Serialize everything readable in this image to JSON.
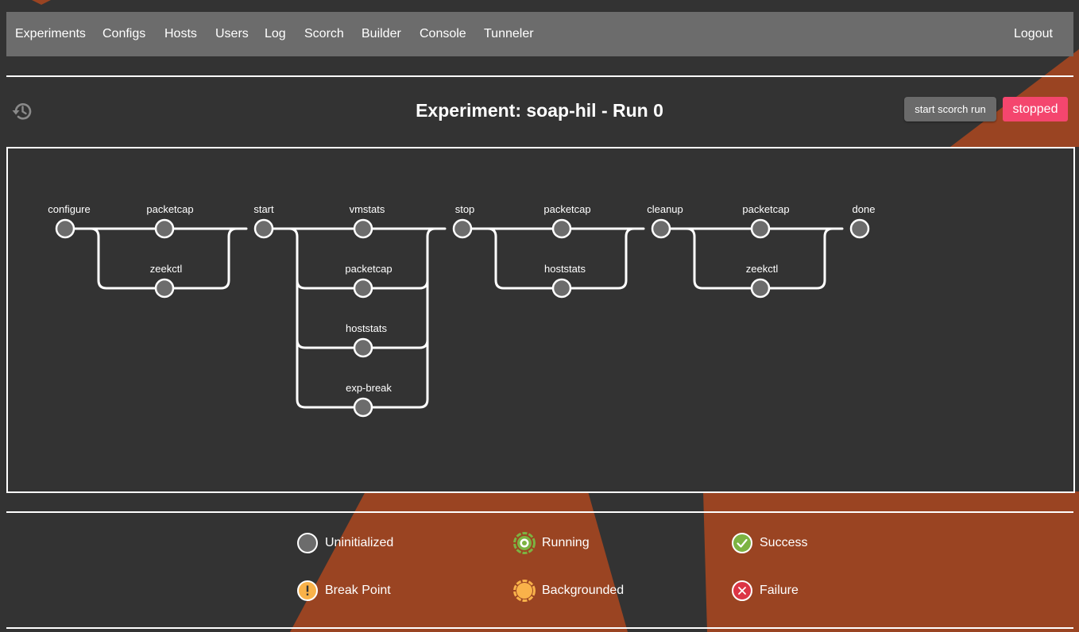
{
  "nav": {
    "items": [
      "Experiments",
      "Configs",
      "Hosts",
      "Users",
      "Log",
      "Scorch",
      "Builder",
      "Console",
      "Tunneler"
    ],
    "logout": "Logout"
  },
  "header": {
    "title": "Experiment: soap-hil - Run 0",
    "history_icon": "history-icon",
    "run_button": "start scorch run",
    "status": "stopped",
    "status_color": "#f4466e"
  },
  "pipeline": {
    "nodes": [
      {
        "id": "configure",
        "label": "configure"
      },
      {
        "id": "packetcap1",
        "label": "packetcap"
      },
      {
        "id": "zeekctl1",
        "label": "zeekctl"
      },
      {
        "id": "start",
        "label": "start"
      },
      {
        "id": "vmstats",
        "label": "vmstats"
      },
      {
        "id": "packetcap2",
        "label": "packetcap"
      },
      {
        "id": "hoststats1",
        "label": "hoststats"
      },
      {
        "id": "exp-break",
        "label": "exp-break"
      },
      {
        "id": "stop",
        "label": "stop"
      },
      {
        "id": "packetcap3",
        "label": "packetcap"
      },
      {
        "id": "hoststats2",
        "label": "hoststats"
      },
      {
        "id": "cleanup",
        "label": "cleanup"
      },
      {
        "id": "packetcap4",
        "label": "packetcap"
      },
      {
        "id": "zeekctl2",
        "label": "zeekctl"
      },
      {
        "id": "done",
        "label": "done"
      }
    ],
    "node_status": "uninitialized"
  },
  "legend": [
    {
      "label": "Uninitialized",
      "icon": "uninitialized-icon"
    },
    {
      "label": "Running",
      "icon": "running-icon"
    },
    {
      "label": "Success",
      "icon": "success-icon"
    },
    {
      "label": "Break Point",
      "icon": "breakpoint-icon"
    },
    {
      "label": "Backgrounded",
      "icon": "backgrounded-icon"
    },
    {
      "label": "Failure",
      "icon": "failure-icon"
    }
  ],
  "colors": {
    "background": "#333333",
    "accent": "#9a4422",
    "uninitialized": "#6c6c6c",
    "running": "#7cb342",
    "success": "#7cb342",
    "breakpoint": "#f9b24a",
    "backgrounded": "#f9b24a",
    "failure": "#dc3545"
  }
}
